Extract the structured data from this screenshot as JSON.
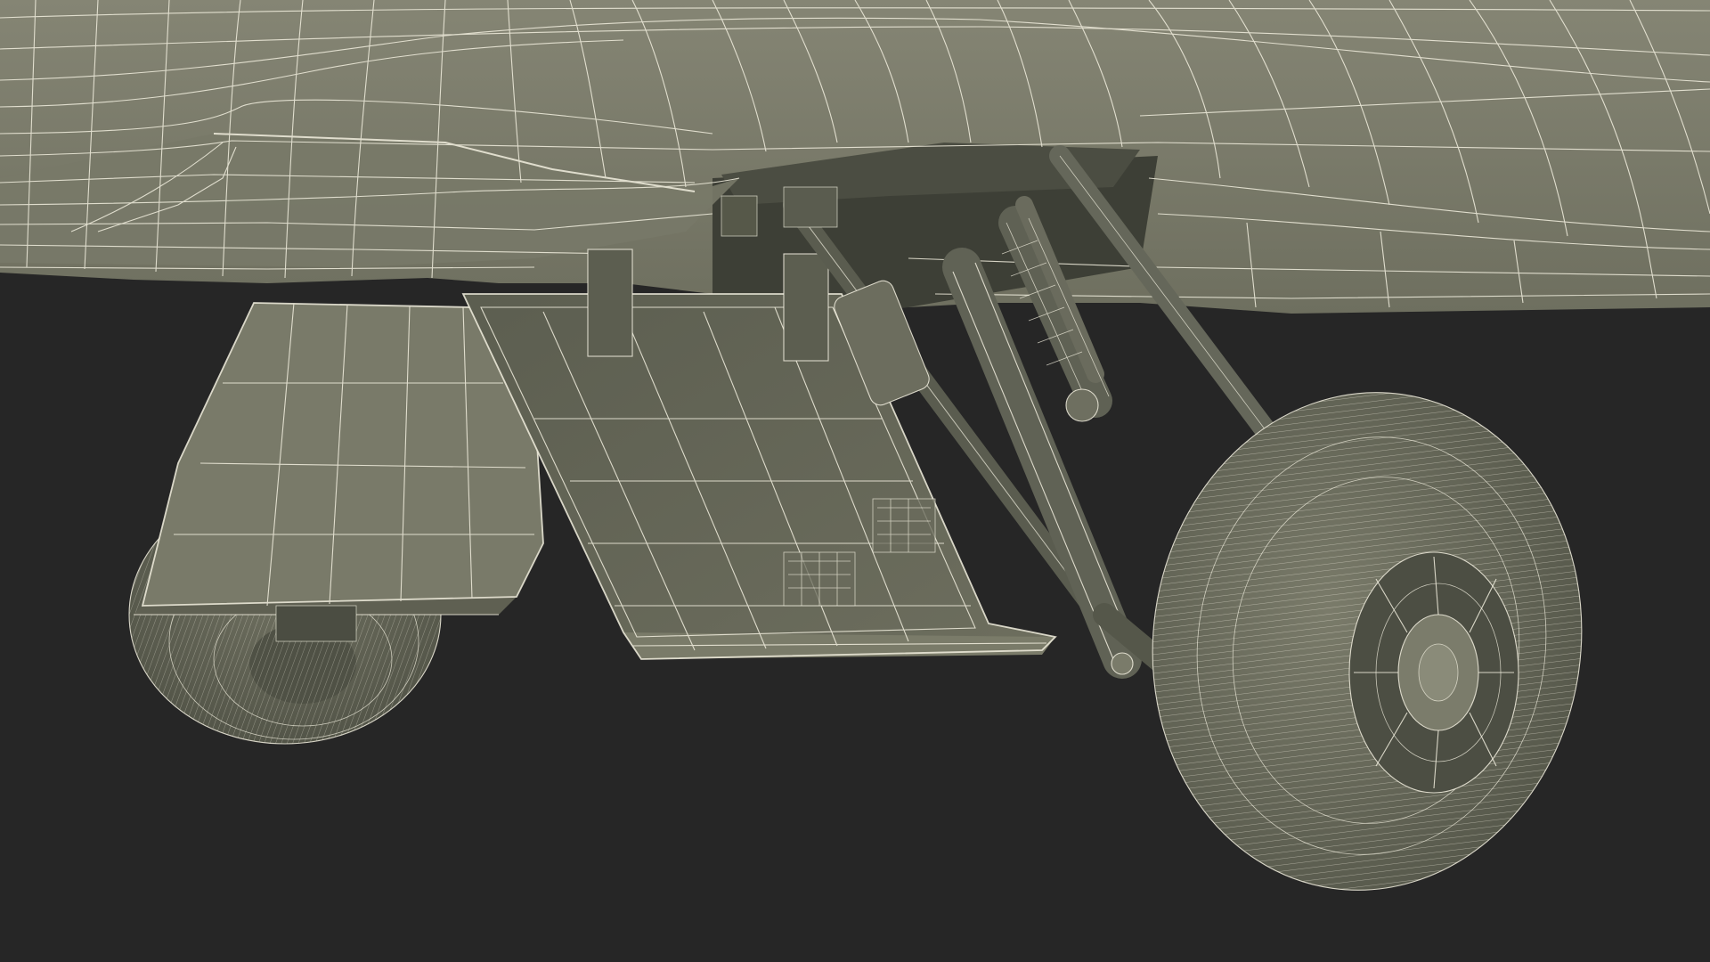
{
  "scene": {
    "subject": "aircraft-main-landing-gear-wireframe",
    "render_style": "wireframe-on-clay",
    "colors": {
      "background": "#262626",
      "surface_light": "#7c7c6b",
      "surface_mid": "#6f705f",
      "surface_dark": "#55574a",
      "shadow": "#3c3e35",
      "wire": "#f2efdf"
    }
  }
}
